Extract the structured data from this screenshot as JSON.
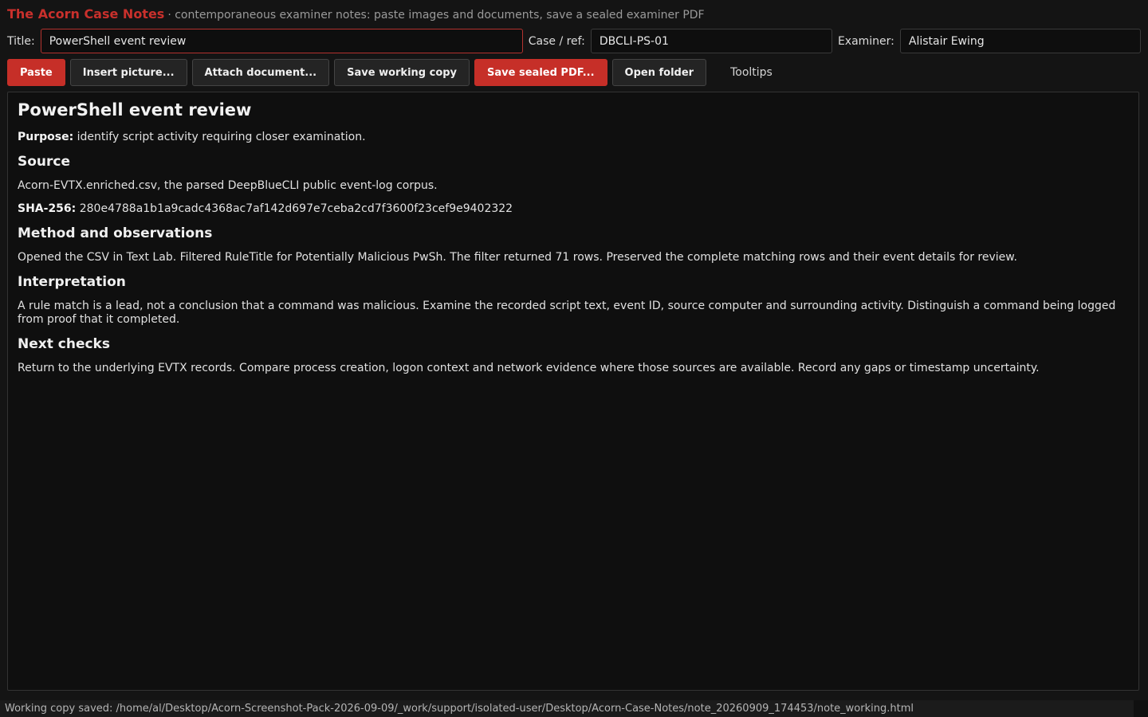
{
  "app": {
    "title": "The Acorn Case Notes",
    "subtitle": "· contemporaneous examiner notes: paste images and documents, save a sealed examiner PDF"
  },
  "fields": {
    "title_label": "Title:",
    "title_value": "PowerShell event review",
    "case_label": "Case / ref:",
    "case_value": "DBCLI-PS-01",
    "examiner_label": "Examiner:",
    "examiner_value": "Alistair Ewing"
  },
  "toolbar": {
    "paste": "Paste",
    "insert_picture": "Insert picture...",
    "attach_document": "Attach document...",
    "save_working_copy": "Save working copy",
    "save_sealed_pdf": "Save sealed PDF...",
    "open_folder": "Open folder",
    "tooltips": "Tooltips"
  },
  "document": {
    "title": "PowerShell event review",
    "purpose_label": "Purpose:",
    "purpose_text": " identify script activity requiring closer examination.",
    "source_heading": "Source",
    "source_text": "Acorn-EVTX.enriched.csv, the parsed DeepBlueCLI public event-log corpus.",
    "sha_label": "SHA-256:",
    "sha_value": " 280e4788a1b1a9cadc4368ac7af142d697e7ceba2cd7f3600f23cef9e9402322",
    "method_heading": "Method and observations",
    "method_text": "Opened the CSV in Text Lab. Filtered RuleTitle for Potentially Malicious PwSh. The filter returned 71 rows. Preserved the complete matching rows and their event details for review.",
    "interpretation_heading": "Interpretation",
    "interpretation_text": "A rule match is a lead, not a conclusion that a command was malicious. Examine the recorded script text, event ID, source computer and surrounding activity. Distinguish a command being logged from proof that it completed.",
    "next_heading": "Next checks",
    "next_text": "Return to the underlying EVTX records. Compare process creation, logon context and network evidence where those sources are available. Record any gaps or timestamp uncertainty."
  },
  "status": {
    "text": "Working copy saved: /home/al/Desktop/Acorn-Screenshot-Pack-2026-09-09/_work/support/isolated-user/Desktop/Acorn-Case-Notes/note_20260909_174453/note_working.html"
  },
  "colors": {
    "accent": "#c62f28",
    "background": "#141414",
    "editor_background": "#0f0f0f"
  }
}
